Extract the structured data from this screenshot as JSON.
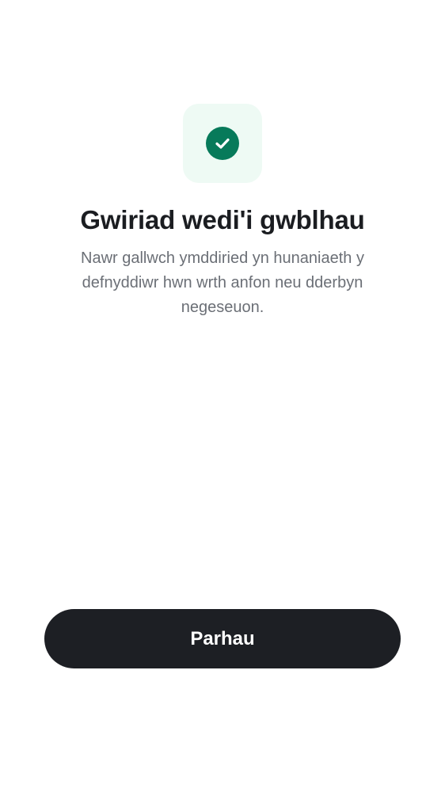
{
  "verification": {
    "icon": "check-circle-icon",
    "title": "Gwiriad wedi'i gwblhau",
    "description": "Nawr gallwch ymddiried yn hunaniaeth y defnyddiwr hwn wrth anfon neu dderbyn negeseuon."
  },
  "actions": {
    "continue_label": "Parhau"
  },
  "colors": {
    "success_green": "#077a5a",
    "icon_tile_background": "#eefaf4",
    "button_background": "#1d1f24"
  }
}
